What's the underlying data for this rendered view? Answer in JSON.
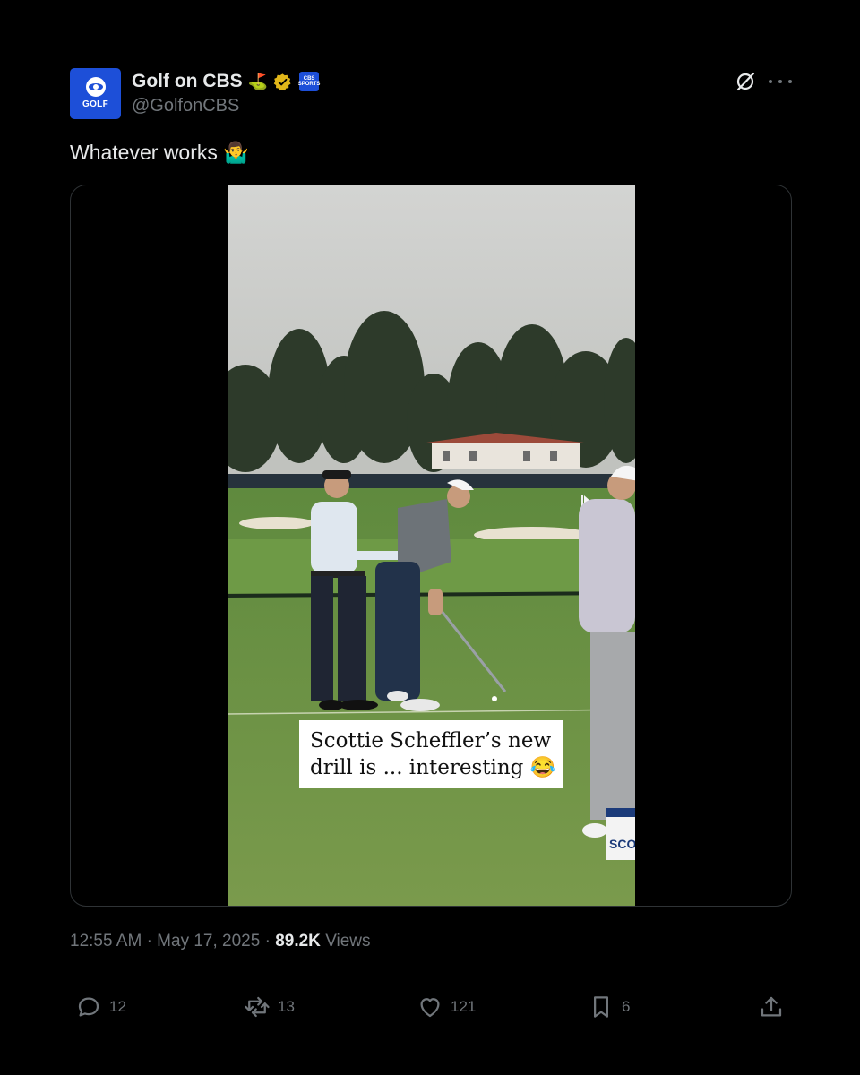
{
  "account": {
    "display_name": "Golf on CBS",
    "handle": "@GolfonCBS",
    "avatar_brand": "GOLF",
    "badge_text": "CBS SPORTS",
    "name_emoji": "⛳️"
  },
  "post": {
    "text": "Whatever works 🤷‍♂️",
    "video_caption_line1": "Scottie Scheffler’s new",
    "video_caption_line2": "drill is ... interesting 😂",
    "sign_text": "SCO"
  },
  "meta": {
    "time": "12:55 AM",
    "separator": "·",
    "date": "May 17, 2025",
    "views_count": "89.2K",
    "views_label": "Views"
  },
  "actions": {
    "replies": "12",
    "reposts": "13",
    "likes": "121",
    "bookmarks": "6"
  },
  "icons": {
    "grok": "grok-icon",
    "more": "more-icon",
    "reply": "reply-icon",
    "repost": "repost-icon",
    "like": "heart-icon",
    "bookmark": "bookmark-icon",
    "share": "share-icon"
  },
  "colors": {
    "background": "#000000",
    "text_primary": "#e7e9ea",
    "text_secondary": "#71767b",
    "border": "#2f3336",
    "cbs_blue": "#1d4fd8",
    "verified_gold": "#e2b719"
  }
}
